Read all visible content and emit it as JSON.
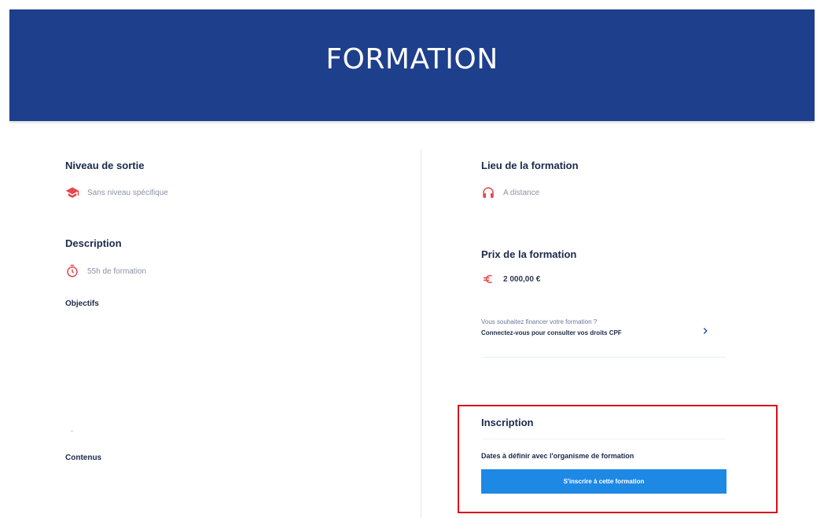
{
  "header": {
    "title": "FORMATION"
  },
  "left": {
    "niveau_title": "Niveau de sortie",
    "niveau_value": "Sans niveau spécifique",
    "description_title": "Description",
    "duree_value": "55h de formation",
    "objectifs_label": "Objectifs",
    "contenus_label": "Contenus"
  },
  "right": {
    "lieu_title": "Lieu de la formation",
    "lieu_value": "A distance",
    "prix_title": "Prix de la formation",
    "prix_value": "2 000,00 €",
    "cpf": {
      "line1": "Vous souhaitez financer votre formation ?",
      "line2": "Connectez-vous pour consulter vos droits CPF"
    },
    "inscription": {
      "title": "Inscription",
      "dates_text": "Dates à définir avec l'organisme de formation",
      "button_label": "S'inscrire à cette formation"
    }
  },
  "colors": {
    "banner": "#1e3f8c",
    "accent_red": "#e5484d",
    "highlight_box": "#d90f18",
    "button": "#1e88e5"
  },
  "icons": {
    "niveau": "graduation-cap-icon",
    "duree": "timer-icon",
    "lieu": "headphones-icon",
    "prix": "euro-icon",
    "cpf": "chevron-right-icon"
  }
}
